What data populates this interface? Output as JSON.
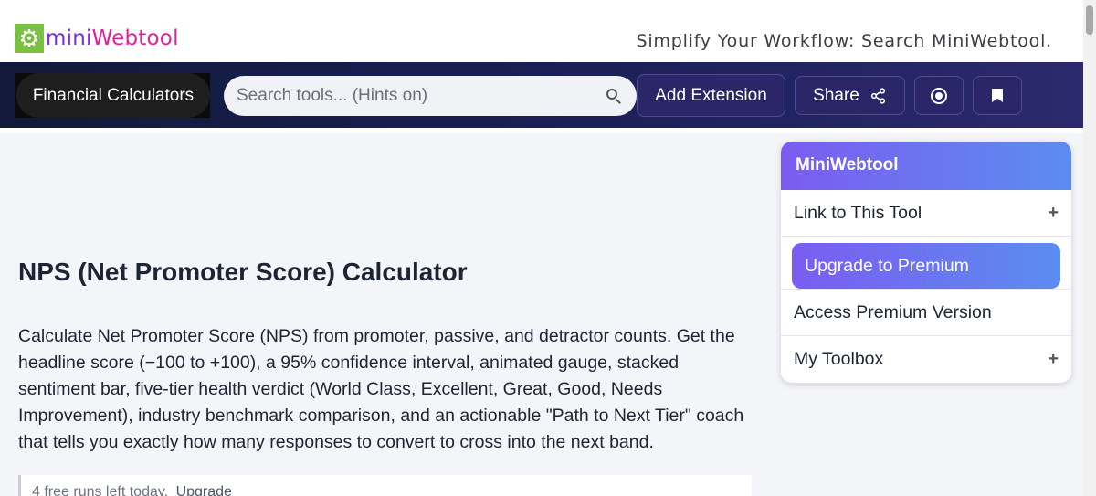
{
  "header": {
    "logo_mini": "mini",
    "logo_webtool": "Webtool",
    "tagline": "Simplify Your Workflow: Search MiniWebtool."
  },
  "nav": {
    "category_label": "Financial Calculators",
    "search_placeholder": "Search tools... (Hints on)",
    "add_extension_label": "Add Extension",
    "share_label": "Share"
  },
  "main": {
    "title": "NPS (Net Promoter Score) Calculator",
    "description": "Calculate Net Promoter Score (NPS) from promoter, passive, and detractor counts. Get the headline score (−100 to +100), a 95% confidence interval, animated gauge, stacked sentiment bar, five-tier health verdict (World Class, Excellent, Great, Good, Needs Improvement), industry benchmark comparison, and an actionable \"Path to Next Tier\" coach that tells you exactly how many responses to convert to cross into the next band.",
    "runs_text": "4 free runs left today.",
    "runs_upgrade": "Upgrade"
  },
  "panel": {
    "title": "MiniWebtool",
    "link_label": "Link to This Tool",
    "premium_button": "Upgrade to Premium",
    "access_label": "Access Premium Version",
    "toolbox_label": "My Toolbox",
    "plus_symbol": "+"
  },
  "colors": {
    "nav_bg": "#1a1f55",
    "accent_purple": "#7b5cf0",
    "accent_blue": "#5b8def",
    "logo_mini": "#7b2fd8",
    "logo_webtool": "#e0219c",
    "logo_gear_bg": "#7ac143"
  },
  "icons": {
    "logo": "gear-icon",
    "search": "search-icon",
    "share": "share-icon",
    "record": "record-icon",
    "bookmark": "bookmark-icon"
  }
}
